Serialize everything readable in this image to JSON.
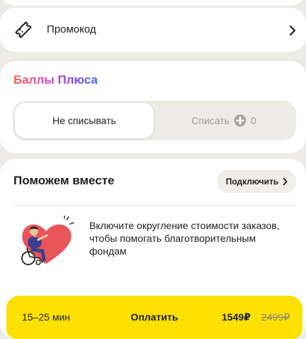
{
  "promo": {
    "label": "Промокод",
    "icon": "ticket-icon"
  },
  "plus_points": {
    "title": "Баллы Плюса",
    "option_keep": "Не списывать",
    "option_spend": "Списать",
    "spend_amount": "0",
    "selected": "option_keep"
  },
  "help": {
    "title": "Поможем вместе",
    "connect_label": "Подключить",
    "description": "Включите округление стоимости заказов, чтобы помогать благотворительным фондам"
  },
  "pay_bar": {
    "eta": "15–25 мин",
    "pay_label": "Оплатить",
    "price": "1549₽",
    "old_price": "2499₽"
  },
  "colors": {
    "accent_yellow": "#fce000",
    "background": "#ecebe8",
    "heart": "#e8555a"
  }
}
